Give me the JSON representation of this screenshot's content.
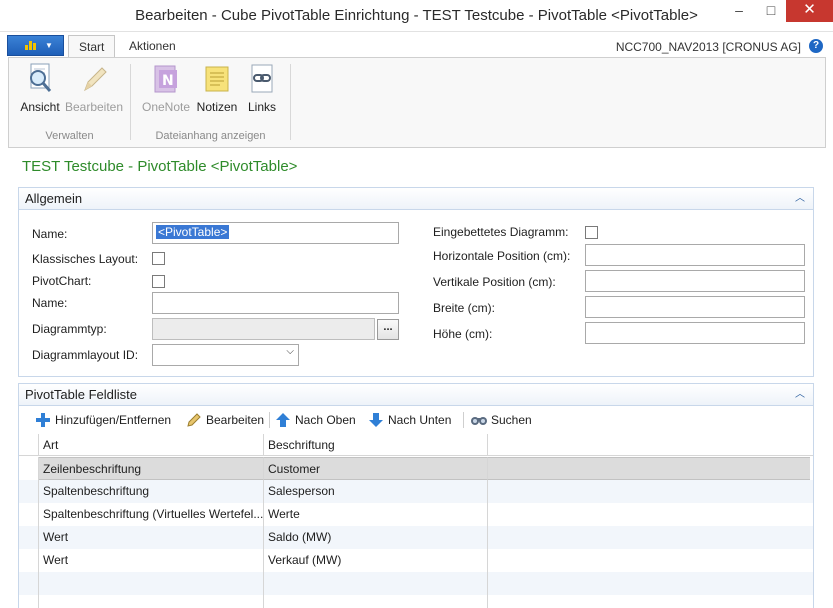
{
  "window": {
    "title": "Bearbeiten - Cube PivotTable Einrichtung - TEST Testcube - PivotTable <PivotTable>",
    "minimize_label": "–",
    "maximize_label": "□",
    "close_label": "✕"
  },
  "ribbon": {
    "tabs": [
      {
        "label": "Start"
      },
      {
        "label": "Aktionen"
      }
    ],
    "company": "NCC700_NAV2013 [CRONUS AG]",
    "help_label": "?",
    "buttons": [
      {
        "label": "Ansicht",
        "icon": "magnifier-icon"
      },
      {
        "label": "Bearbeiten",
        "icon": "pencil-icon"
      },
      {
        "label": "OneNote",
        "icon": "onenote-icon"
      },
      {
        "label": "Notizen",
        "icon": "note-icon"
      },
      {
        "label": "Links",
        "icon": "links-icon"
      }
    ],
    "groups": [
      {
        "label": "Verwalten"
      },
      {
        "label": "Dateianhang anzeigen"
      }
    ]
  },
  "page": {
    "title": "TEST Testcube - PivotTable <PivotTable>"
  },
  "general": {
    "header": "Allgemein",
    "name_label": "Name:",
    "name_value": "<PivotTable>",
    "classic_layout_label": "Klassisches Layout:",
    "pivotchart_label": "PivotChart:",
    "chart_name_label": "Name:",
    "chart_name_value": "",
    "chart_type_label": "Diagrammtyp:",
    "chart_type_value": "",
    "assist_label": "...",
    "chart_layout_label": "Diagrammlayout ID:",
    "chart_layout_value": "",
    "embedded_chart_label": "Eingebettetes Diagramm:",
    "hpos_label": "Horizontale Position (cm):",
    "hpos_value": "",
    "vpos_label": "Vertikale Position (cm):",
    "vpos_value": "",
    "width_label": "Breite (cm):",
    "width_value": "",
    "height_label": "Höhe (cm):",
    "height_value": ""
  },
  "fieldlist": {
    "header": "PivotTable Feldliste",
    "toolbar": {
      "add_remove": "Hinzufügen/Entfernen",
      "edit": "Bearbeiten",
      "move_up": "Nach Oben",
      "move_down": "Nach Unten",
      "search": "Suchen"
    },
    "columns": [
      "Art",
      "Beschriftung"
    ],
    "rows": [
      {
        "art": "Zeilenbeschriftung",
        "beschriftung": "Customer"
      },
      {
        "art": "Spaltenbeschriftung",
        "beschriftung": "Salesperson"
      },
      {
        "art": "Spaltenbeschriftung (Virtuelles Wertefel...",
        "beschriftung": "Werte"
      },
      {
        "art": "Wert",
        "beschriftung": "Saldo (MW)"
      },
      {
        "art": "Wert",
        "beschriftung": "Verkauf (MW)"
      }
    ]
  },
  "colors": {
    "accent": "#2e8b2a",
    "selection": "#3a78d4",
    "close": "#c7372f"
  }
}
